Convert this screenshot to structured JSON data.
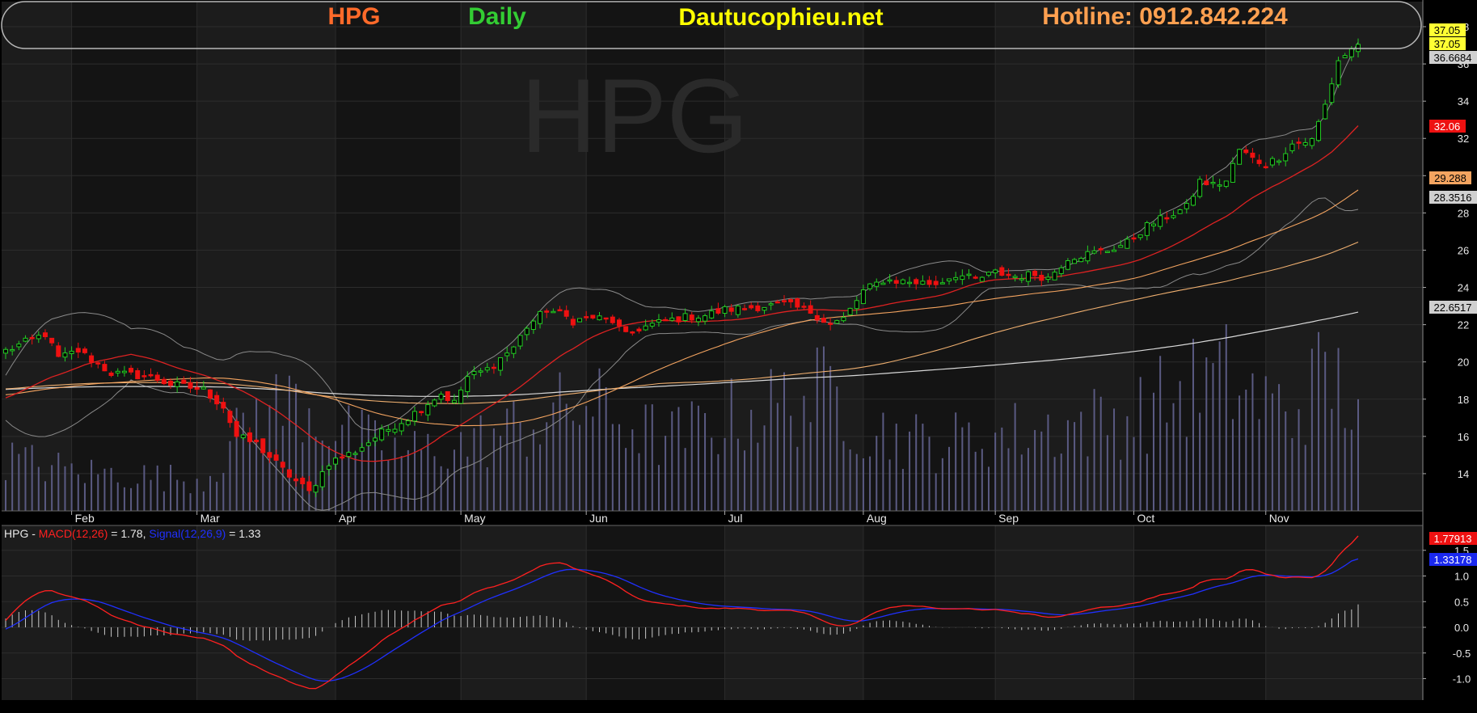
{
  "banner": {
    "symbol": "HPG",
    "interval": "Daily",
    "site": "Dautucophieu.net",
    "hotline": "Hotline: 0912.842.224"
  },
  "watermark": "HPG",
  "colors": {
    "background": "#000000",
    "panel": "#141414",
    "band_alt": "#1c1c1c",
    "up": "#22cc22",
    "down": "#ee1111",
    "ma20": "#dd2222",
    "ma50": "#f4a460",
    "ma100": "#f0b070",
    "ma200": "#d8d8d8",
    "bollinger": "#8a8a8a",
    "volume": "#5a5a82",
    "macd": "#ff2020",
    "signal": "#2030ff",
    "symbol_text": "#ff6a2a",
    "interval_text": "#33cc33",
    "site_text": "#ffff00",
    "hotline_text": "#ffa050"
  },
  "price_tags": {
    "last_high": "37.05",
    "last_close": "37.05",
    "bb_upper": "36.6684",
    "ma20": "32.06",
    "ma50": "29.288",
    "bb_lower": "28.3516",
    "ma200": "22.6517"
  },
  "macd_tags": {
    "macd": "1.77913",
    "signal": "1.33178"
  },
  "macd_legend": {
    "symbol": "HPG",
    "dash": " - ",
    "macd_label": "MACD(12,26)",
    "macd_value": " = 1.78, ",
    "signal_label": "Signal(12,26,9)",
    "signal_value": " = 1.33"
  },
  "chart_data": [
    {
      "type": "candlestick",
      "title": "HPG Daily",
      "ylim": [
        12,
        38
      ],
      "y_ticks": [
        "14",
        "16",
        "18",
        "20",
        "22",
        "24",
        "26",
        "28",
        "30",
        "32",
        "34",
        "36",
        "38"
      ],
      "x_tick_labels": [
        "Feb",
        "Mar",
        "Apr",
        "May",
        "Jun",
        "Jul",
        "Aug",
        "Sep",
        "Oct",
        "Nov"
      ],
      "x_tick_index": [
        10,
        29,
        50,
        69,
        88,
        109,
        130,
        150,
        171,
        191
      ],
      "grid": true,
      "n_bars": 206,
      "price_anchors": [
        [
          0,
          20.6
        ],
        [
          6,
          21.5
        ],
        [
          8,
          20.2
        ],
        [
          11,
          20.6
        ],
        [
          16,
          19.4
        ],
        [
          22,
          19.2
        ],
        [
          25,
          18.8
        ],
        [
          30,
          18.5
        ],
        [
          33,
          17.6
        ],
        [
          35,
          16.0
        ],
        [
          38,
          15.6
        ],
        [
          42,
          14.2
        ],
        [
          46,
          13.0
        ],
        [
          49,
          14.6
        ],
        [
          53,
          15.2
        ],
        [
          57,
          16.2
        ],
        [
          61,
          17.0
        ],
        [
          64,
          17.8
        ],
        [
          66,
          18.3
        ],
        [
          68,
          17.8
        ],
        [
          70,
          19.2
        ],
        [
          73,
          19.6
        ],
        [
          77,
          20.8
        ],
        [
          79,
          21.9
        ],
        [
          82,
          22.8
        ],
        [
          84,
          22.6
        ],
        [
          86,
          22.2
        ],
        [
          89,
          22.4
        ],
        [
          92,
          22.2
        ],
        [
          94,
          21.4
        ],
        [
          96,
          21.8
        ],
        [
          100,
          22.2
        ],
        [
          103,
          22.4
        ],
        [
          106,
          22.5
        ],
        [
          109,
          22.8
        ],
        [
          112,
          22.9
        ],
        [
          115,
          23.0
        ],
        [
          118,
          23.1
        ],
        [
          122,
          22.7
        ],
        [
          125,
          22.0
        ],
        [
          127,
          22.3
        ],
        [
          130,
          23.8
        ],
        [
          133,
          24.4
        ],
        [
          137,
          24.3
        ],
        [
          141,
          24.2
        ],
        [
          144,
          24.7
        ],
        [
          147,
          24.4
        ],
        [
          150,
          24.8
        ],
        [
          153,
          24.6
        ],
        [
          156,
          24.7
        ],
        [
          158,
          24.5
        ],
        [
          161,
          25.6
        ],
        [
          164,
          25.8
        ],
        [
          167,
          26.0
        ],
        [
          170,
          26.4
        ],
        [
          173,
          27.3
        ],
        [
          176,
          27.8
        ],
        [
          179,
          28.3
        ],
        [
          181,
          29.7
        ],
        [
          183,
          29.5
        ],
        [
          185,
          29.7
        ],
        [
          187,
          31.4
        ],
        [
          189,
          30.9
        ],
        [
          191,
          30.6
        ],
        [
          193,
          31.0
        ],
        [
          195,
          31.7
        ],
        [
          198,
          31.9
        ],
        [
          200,
          33.8
        ],
        [
          202,
          36.2
        ],
        [
          205,
          37.05
        ]
      ],
      "volume_anchors": [
        [
          0,
          1.2
        ],
        [
          10,
          0.9
        ],
        [
          20,
          0.8
        ],
        [
          30,
          0.7
        ],
        [
          38,
          2.2
        ],
        [
          45,
          2.5
        ],
        [
          50,
          1.8
        ],
        [
          60,
          1.3
        ],
        [
          70,
          1.5
        ],
        [
          80,
          2.0
        ],
        [
          88,
          2.4
        ],
        [
          100,
          1.6
        ],
        [
          110,
          2.1
        ],
        [
          120,
          2.5
        ],
        [
          126,
          2.7
        ],
        [
          130,
          1.9
        ],
        [
          140,
          1.5
        ],
        [
          150,
          1.7
        ],
        [
          160,
          1.9
        ],
        [
          170,
          2.1
        ],
        [
          180,
          2.8
        ],
        [
          185,
          3.0
        ],
        [
          190,
          2.5
        ],
        [
          195,
          2.2
        ],
        [
          200,
          3.1
        ],
        [
          205,
          2.4
        ]
      ],
      "series": [
        {
          "name": "MA20",
          "kind": "moving_average",
          "period": 20,
          "last": 32.06
        },
        {
          "name": "MA50",
          "kind": "moving_average",
          "period": 50,
          "last": 29.288
        },
        {
          "name": "MA100",
          "kind": "moving_average",
          "period": 100
        },
        {
          "name": "MA200",
          "kind": "moving_average",
          "period": 200,
          "last": 22.6517
        },
        {
          "name": "Bollinger",
          "kind": "bollinger",
          "period": 20,
          "upper_last": 36.6684,
          "lower_last": 28.3516
        }
      ],
      "last_close": 37.05
    },
    {
      "type": "line",
      "title": "MACD(12,26)",
      "ylim": [
        -1.4,
        1.9
      ],
      "y_ticks": [
        "-1.0",
        "-0.5",
        "0.0",
        "0.5",
        "1.0",
        "1.5"
      ],
      "grid": true,
      "series": [
        {
          "name": "MACD(12,26)",
          "last": 1.77913
        },
        {
          "name": "Signal(12,26,9)",
          "last": 1.33178
        }
      ]
    }
  ]
}
